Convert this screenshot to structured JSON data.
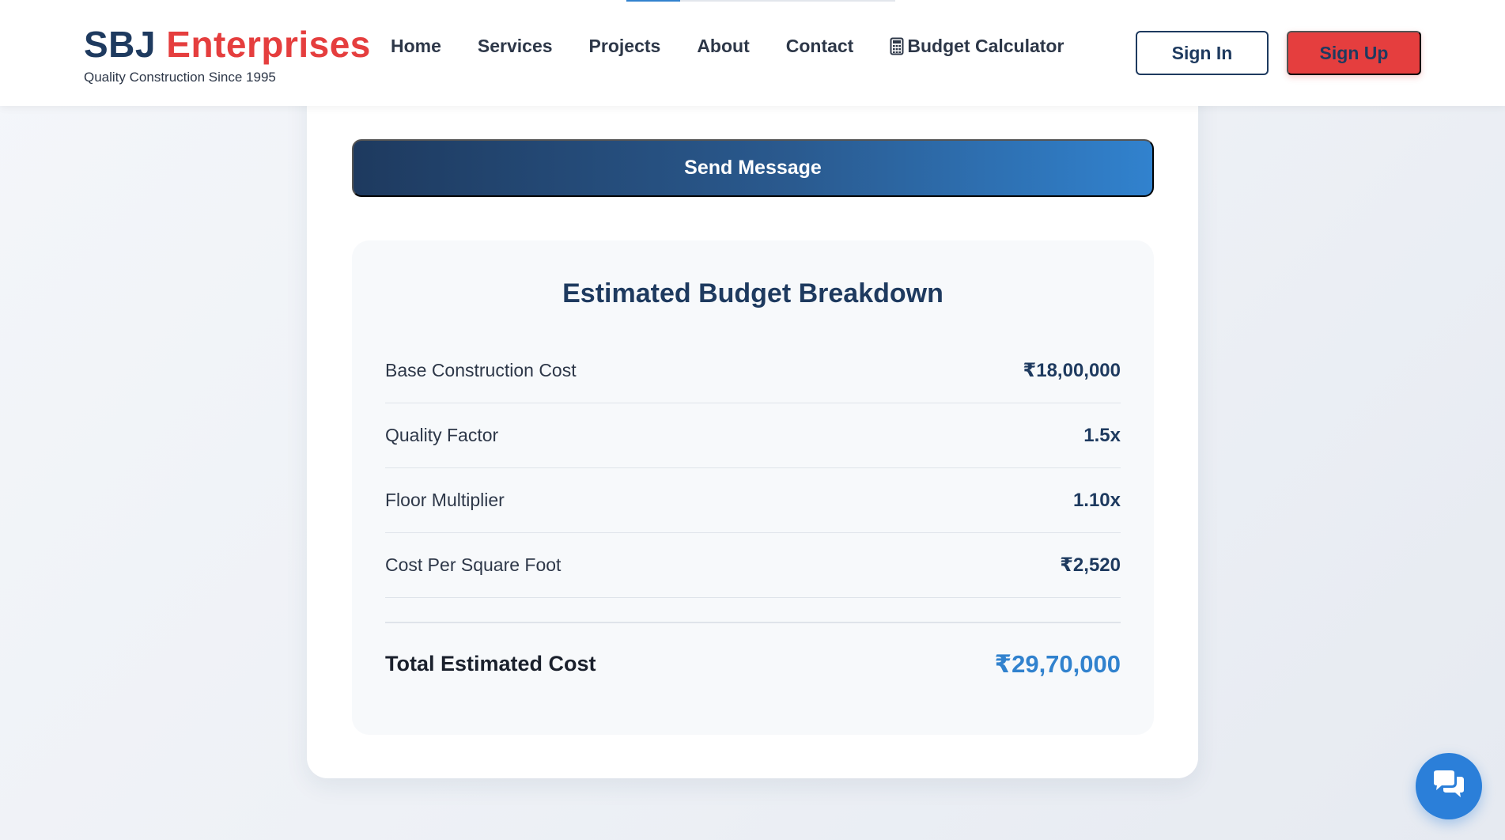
{
  "colors": {
    "brand_primary": "#1e3a5f",
    "brand_accent": "#e53e3e",
    "highlight": "#3182ce",
    "chat_button": "#2b7fd9"
  },
  "header": {
    "logo_first": "SBJ",
    "logo_second": "Enterprises",
    "tagline": "Quality Construction Since 1995",
    "nav": {
      "home": "Home",
      "services": "Services",
      "projects": "Projects",
      "about": "About",
      "contact": "Contact",
      "budget_calculator": "Budget Calculator"
    },
    "nav_calc_icon": "calculator-icon",
    "sign_in": "Sign In",
    "sign_up": "Sign Up",
    "scroll_progress": 0.2
  },
  "form": {
    "send_label": "Send Message"
  },
  "breakdown": {
    "title": "Estimated Budget Breakdown",
    "rows": [
      {
        "label": "Base Construction Cost",
        "value": "₹18,00,000"
      },
      {
        "label": "Quality Factor",
        "value": "1.5x"
      },
      {
        "label": "Floor Multiplier",
        "value": "1.10x"
      },
      {
        "label": "Cost Per Square Foot",
        "value": "₹2,520"
      }
    ],
    "total_label": "Total Estimated Cost",
    "total_value": "₹29,70,000"
  },
  "chat": {
    "icon": "chat-bubbles-icon"
  }
}
